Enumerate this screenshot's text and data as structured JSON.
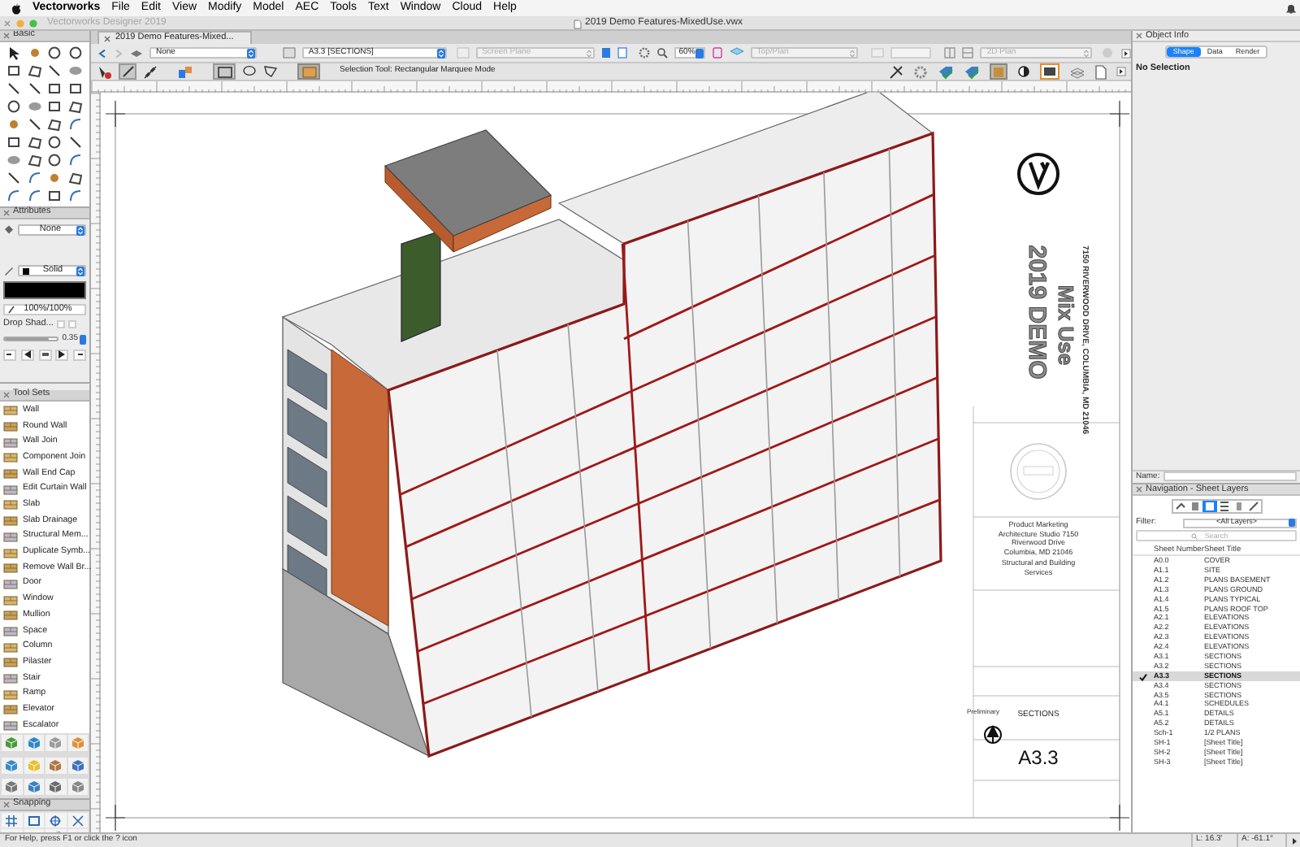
{
  "menu_bar": {
    "app": "Vectorworks",
    "items": [
      "File",
      "Edit",
      "View",
      "Modify",
      "Model",
      "AEC",
      "Tools",
      "Text",
      "Window",
      "Cloud",
      "Help"
    ]
  },
  "window": {
    "app_title": "Vectorworks Designer 2019",
    "title": "2019 Demo Features-MixedUse.vwx"
  },
  "palettes": {
    "basic": {
      "title": "Basic"
    },
    "attributes": {
      "title": "Attributes",
      "fill": "None",
      "pen": "Solid",
      "opacity": "100%/100%",
      "drop_shadow": "Drop Shad...",
      "line_weight": {
        "value": "0.35",
        "level": 0.85
      }
    },
    "tool_sets": {
      "title": "Tool Sets",
      "items": [
        "Wall",
        "Round Wall",
        "Wall Join",
        "Component Join",
        "Wall End Cap",
        "Edit Curtain Wall",
        "Slab",
        "Slab Drainage",
        "Structural Mem...",
        "Duplicate Symb...",
        "Remove Wall Br...",
        "Door",
        "Window",
        "Mullion",
        "Space",
        "Column",
        "Pilaster",
        "Stair",
        "Ramp",
        "Elevator",
        "Escalator"
      ]
    },
    "snapping": {
      "title": "Snapping"
    }
  },
  "document_tab": {
    "label": "2019 Demo Features-Mixed..."
  },
  "view_bar": {
    "class": {
      "value": "None",
      "disabled": false
    },
    "layer": {
      "value": "A3.3 [SECTIONS]",
      "disabled": false
    },
    "plane": {
      "value": "Screen Plane",
      "disabled": true
    },
    "zoom": "60%",
    "view": {
      "value": "Top/Plan",
      "disabled": true
    },
    "render": {
      "value": "2D Plan",
      "disabled": true
    }
  },
  "tool_bar": {
    "mode_hint": "Selection Tool: Rectangular Marquee Mode"
  },
  "title_block": {
    "project": "2019 DEMO",
    "subtitle": "Mix Use",
    "address": "7150 RIVERWOOD DRIVE, COLUMBIA, MD 21046",
    "firm": "Product Marketing Architecture Studio 7150 Riverwood Drive Columbia, MD 21046",
    "consultant": "Structural and Building Services",
    "stamp": "Preliminary",
    "sheet_title": "SECTIONS",
    "sheet_number": "A3.3"
  },
  "object_info": {
    "title": "Object Info",
    "tabs": [
      {
        "label": "Shape",
        "selected": true
      },
      {
        "label": "Data",
        "selected": false
      },
      {
        "label": "Render",
        "selected": false
      }
    ],
    "selection": "No Selection",
    "name_label": "Name:"
  },
  "navigation": {
    "title": "Navigation - Sheet Layers",
    "filter_label": "Filter:",
    "filter": "<All Layers>",
    "search_placeholder": "Search",
    "columns": [
      "Sheet Number",
      "Sheet Title"
    ],
    "rows": [
      {
        "number": "A0.0",
        "title": "COVER",
        "selected": false
      },
      {
        "number": "A1.1",
        "title": "SITE",
        "selected": false
      },
      {
        "number": "A1.2",
        "title": "PLANS BASEMENT",
        "selected": false
      },
      {
        "number": "A1.3",
        "title": "PLANS GROUND",
        "selected": false
      },
      {
        "number": "A1.4",
        "title": "PLANS TYPICAL",
        "selected": false
      },
      {
        "number": "A1.5",
        "title": "PLANS ROOF TOP",
        "selected": false
      },
      {
        "number": "A2.1",
        "title": "ELEVATIONS",
        "selected": false
      },
      {
        "number": "A2.2",
        "title": "ELEVATIONS",
        "selected": false
      },
      {
        "number": "A2.3",
        "title": "ELEVATIONS",
        "selected": false
      },
      {
        "number": "A2.4",
        "title": "ELEVATIONS",
        "selected": false
      },
      {
        "number": "A3.1",
        "title": "SECTIONS",
        "selected": false
      },
      {
        "number": "A3.2",
        "title": "SECTIONS",
        "selected": false
      },
      {
        "number": "A3.3",
        "title": "SECTIONS",
        "selected": true
      },
      {
        "number": "A3.4",
        "title": "SECTIONS",
        "selected": false
      },
      {
        "number": "A3.5",
        "title": "SECTIONS",
        "selected": false
      },
      {
        "number": "A4.1",
        "title": "SCHEDULES",
        "selected": false
      },
      {
        "number": "A5.1",
        "title": "DETAILS",
        "selected": false
      },
      {
        "number": "A5.2",
        "title": "DETAILS",
        "selected": false
      },
      {
        "number": "Sch-1",
        "title": "1/2 PLANS",
        "selected": false
      },
      {
        "number": "SH-1",
        "title": "[Sheet Title]",
        "selected": false
      },
      {
        "number": "SH-2",
        "title": "[Sheet Title]",
        "selected": false
      },
      {
        "number": "SH-3",
        "title": "[Sheet Title]",
        "selected": false
      }
    ]
  },
  "status_bar": {
    "help": "For Help, press F1 or click the ? icon",
    "length": "L: 16.3'",
    "angle": "A: -61.1°"
  }
}
